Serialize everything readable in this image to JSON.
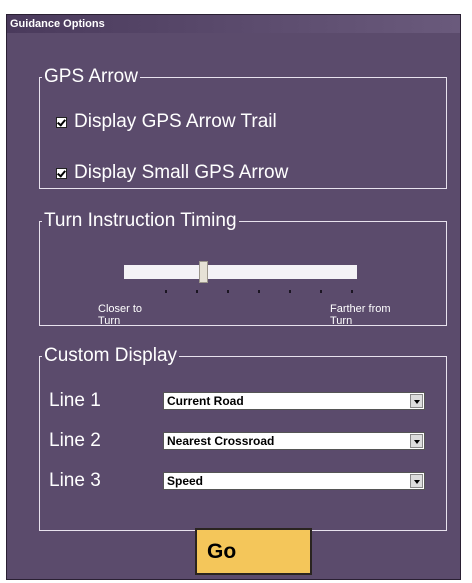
{
  "window": {
    "title": "Guidance Options"
  },
  "gps_arrow": {
    "legend": "GPS Arrow",
    "options": [
      {
        "label": "Display GPS Arrow Trail",
        "checked": true
      },
      {
        "label": "Display Small GPS Arrow",
        "checked": true
      }
    ]
  },
  "turn_timing": {
    "legend": "Turn Instruction Timing",
    "slider_level_fraction": 0.34,
    "min_label": "Closer to\nTurn",
    "max_label": "Farther from\nTurn",
    "tick_count": 7
  },
  "custom_display": {
    "legend": "Custom Display",
    "lines": [
      {
        "label": "Line 1",
        "value": "Current Road"
      },
      {
        "label": "Line 2",
        "value": "Nearest Crossroad"
      },
      {
        "label": "Line 3",
        "value": "Speed"
      }
    ]
  },
  "go_button": {
    "label": "Go"
  },
  "colors": {
    "panel_background": "#5b4b6c",
    "go_button": "#f4c65a",
    "text": "#ffffff"
  }
}
